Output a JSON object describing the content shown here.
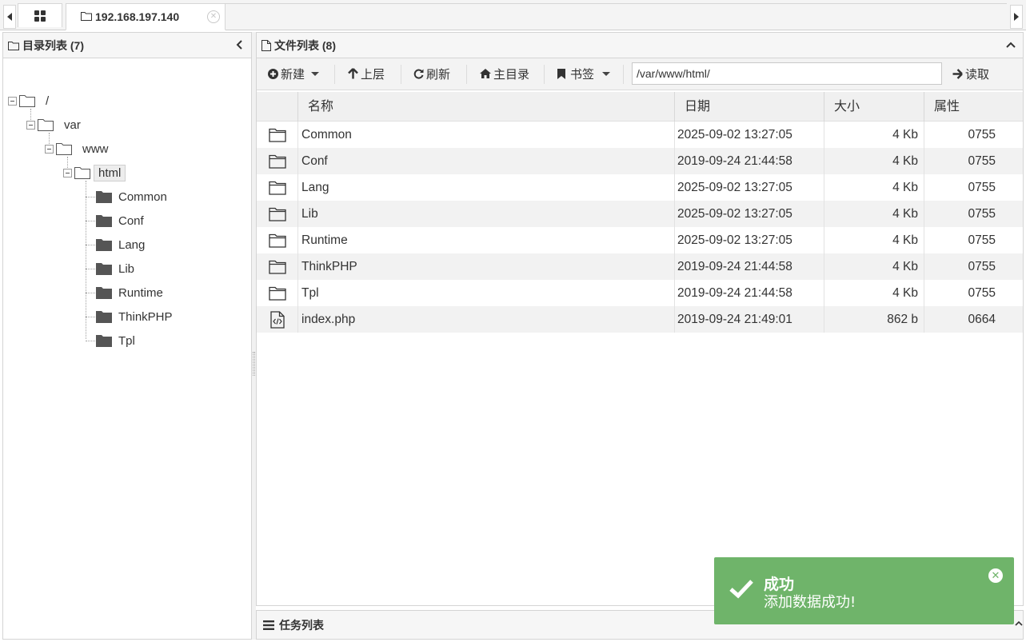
{
  "tabs": {
    "main_tab_label": "192.168.197.140",
    "close_glyph": "✕"
  },
  "left_panel": {
    "title": "目录列表 (7)",
    "tree": [
      {
        "label": "/",
        "depth": 0
      },
      {
        "label": "var",
        "depth": 1
      },
      {
        "label": "www",
        "depth": 2
      },
      {
        "label": "html",
        "depth": 3,
        "selected": true
      },
      {
        "label": "Common",
        "depth": 4
      },
      {
        "label": "Conf",
        "depth": 4
      },
      {
        "label": "Lang",
        "depth": 4
      },
      {
        "label": "Lib",
        "depth": 4
      },
      {
        "label": "Runtime",
        "depth": 4
      },
      {
        "label": "ThinkPHP",
        "depth": 4
      },
      {
        "label": "Tpl",
        "depth": 4
      }
    ]
  },
  "right_panel": {
    "title": "文件列表 (8)",
    "toolbar": {
      "new_label": "新建",
      "up_label": "上层",
      "refresh_label": "刷新",
      "home_label": "主目录",
      "bookmark_label": "书签",
      "path_value": "/var/www/html/",
      "read_label": "读取"
    },
    "columns": [
      "名称",
      "日期",
      "大小",
      "属性"
    ],
    "files": [
      {
        "type": "folder",
        "name": "Common",
        "date": "2025-09-02 13:27:05",
        "size": "4 Kb",
        "perm": "0755"
      },
      {
        "type": "folder",
        "name": "Conf",
        "date": "2019-09-24 21:44:58",
        "size": "4 Kb",
        "perm": "0755"
      },
      {
        "type": "folder",
        "name": "Lang",
        "date": "2025-09-02 13:27:05",
        "size": "4 Kb",
        "perm": "0755"
      },
      {
        "type": "folder",
        "name": "Lib",
        "date": "2025-09-02 13:27:05",
        "size": "4 Kb",
        "perm": "0755"
      },
      {
        "type": "folder",
        "name": "Runtime",
        "date": "2025-09-02 13:27:05",
        "size": "4 Kb",
        "perm": "0755"
      },
      {
        "type": "folder",
        "name": "ThinkPHP",
        "date": "2019-09-24 21:44:58",
        "size": "4 Kb",
        "perm": "0755"
      },
      {
        "type": "folder",
        "name": "Tpl",
        "date": "2019-09-24 21:44:58",
        "size": "4 Kb",
        "perm": "0755"
      },
      {
        "type": "code-file",
        "name": "index.php",
        "date": "2019-09-24 21:49:01",
        "size": "862 b",
        "perm": "0664"
      }
    ]
  },
  "task_panel": {
    "title": "任务列表"
  },
  "toast": {
    "title": "成功",
    "message": "添加数据成功!",
    "color": "#6fb46a"
  },
  "icons": {
    "tab_home": "grid-icon",
    "tree_folder": "folder-outline-icon",
    "tree_leaf": "folder-filled-icon",
    "file_folder": "folder-outline-icon",
    "file_code": "code-file-icon"
  }
}
